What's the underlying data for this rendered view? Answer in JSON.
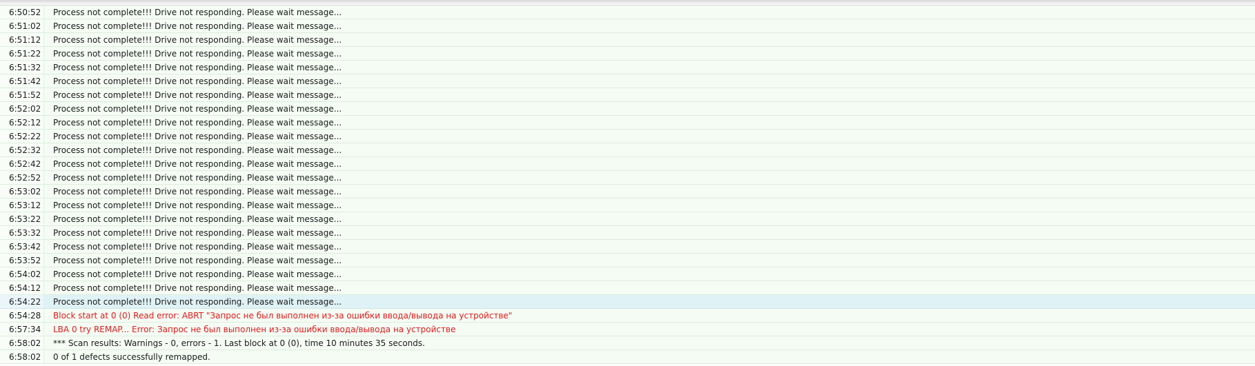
{
  "log": {
    "colors": {
      "row_background": "#f4fcf4",
      "selected_background": "#dff2f6",
      "error_text": "#e01b1b",
      "normal_text": "#1a1a1a"
    },
    "entries": [
      {
        "time": "6:50:52",
        "message": "Process not complete!!! Drive not responding. Please wait message...",
        "level": "info"
      },
      {
        "time": "6:51:02",
        "message": "Process not complete!!! Drive not responding. Please wait message...",
        "level": "info"
      },
      {
        "time": "6:51:12",
        "message": "Process not complete!!! Drive not responding. Please wait message...",
        "level": "info"
      },
      {
        "time": "6:51:22",
        "message": "Process not complete!!! Drive not responding. Please wait message...",
        "level": "info"
      },
      {
        "time": "6:51:32",
        "message": "Process not complete!!! Drive not responding. Please wait message...",
        "level": "info"
      },
      {
        "time": "6:51:42",
        "message": "Process not complete!!! Drive not responding. Please wait message...",
        "level": "info"
      },
      {
        "time": "6:51:52",
        "message": "Process not complete!!! Drive not responding. Please wait message...",
        "level": "info"
      },
      {
        "time": "6:52:02",
        "message": "Process not complete!!! Drive not responding. Please wait message...",
        "level": "info"
      },
      {
        "time": "6:52:12",
        "message": "Process not complete!!! Drive not responding. Please wait message...",
        "level": "info"
      },
      {
        "time": "6:52:22",
        "message": "Process not complete!!! Drive not responding. Please wait message...",
        "level": "info"
      },
      {
        "time": "6:52:32",
        "message": "Process not complete!!! Drive not responding. Please wait message...",
        "level": "info"
      },
      {
        "time": "6:52:42",
        "message": "Process not complete!!! Drive not responding. Please wait message...",
        "level": "info"
      },
      {
        "time": "6:52:52",
        "message": "Process not complete!!! Drive not responding. Please wait message...",
        "level": "info"
      },
      {
        "time": "6:53:02",
        "message": "Process not complete!!! Drive not responding. Please wait message...",
        "level": "info"
      },
      {
        "time": "6:53:12",
        "message": "Process not complete!!! Drive not responding. Please wait message...",
        "level": "info"
      },
      {
        "time": "6:53:22",
        "message": "Process not complete!!! Drive not responding. Please wait message...",
        "level": "info"
      },
      {
        "time": "6:53:32",
        "message": "Process not complete!!! Drive not responding. Please wait message...",
        "level": "info"
      },
      {
        "time": "6:53:42",
        "message": "Process not complete!!! Drive not responding. Please wait message...",
        "level": "info"
      },
      {
        "time": "6:53:52",
        "message": "Process not complete!!! Drive not responding. Please wait message...",
        "level": "info"
      },
      {
        "time": "6:54:02",
        "message": "Process not complete!!! Drive not responding. Please wait message...",
        "level": "info"
      },
      {
        "time": "6:54:12",
        "message": "Process not complete!!! Drive not responding. Please wait message...",
        "level": "info"
      },
      {
        "time": "6:54:22",
        "message": "Process not complete!!! Drive not responding. Please wait message...",
        "level": "info",
        "selected": true
      },
      {
        "time": "6:54:28",
        "message": "Block start at 0 (0) Read error: ABRT \"Запрос не был выполнен из-за ошибки ввода/вывода на устройстве\"",
        "level": "error"
      },
      {
        "time": "6:57:34",
        "message": "LBA 0 try REMAP... Error: Запрос не был выполнен из-за ошибки ввода/вывода на устройстве",
        "level": "error"
      },
      {
        "time": "6:58:02",
        "message": "*** Scan results: Warnings - 0, errors - 1. Last block at 0 (0), time 10 minutes 35 seconds.",
        "level": "info"
      },
      {
        "time": "6:58:02",
        "message": "0 of 1 defects successfully remapped.",
        "level": "info"
      }
    ]
  }
}
